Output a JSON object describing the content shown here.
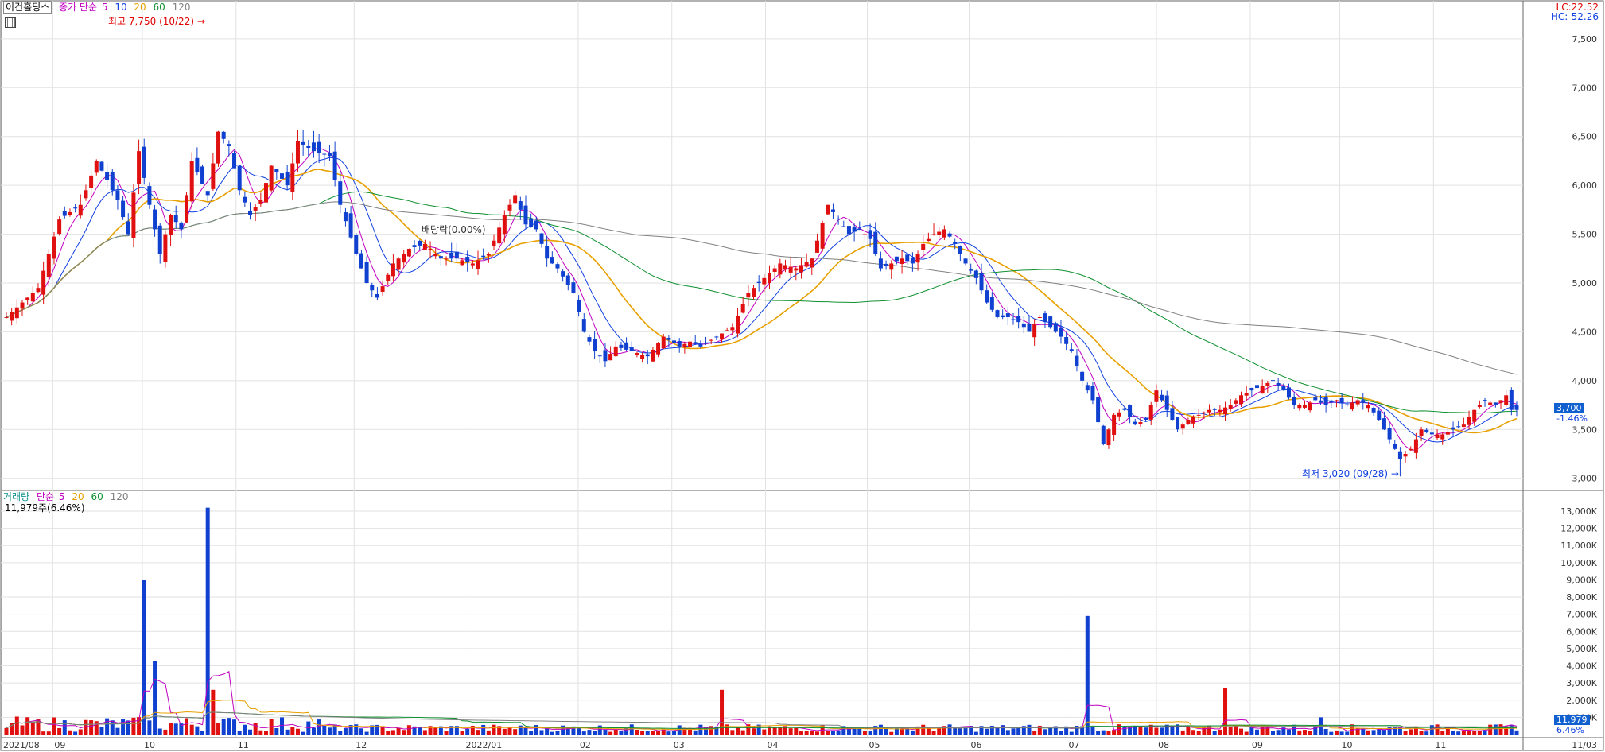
{
  "app": {
    "stock_name": "이건홀딩스",
    "toolbar_icon": "grid-icon"
  },
  "price_legend": {
    "label": "종가 단순",
    "ma": [
      {
        "period": "5",
        "color": "#e00000"
      },
      {
        "period": "10",
        "color": "#1040e0"
      },
      {
        "period": "20",
        "color": "#e8a000"
      },
      {
        "period": "60",
        "color": "#109030"
      },
      {
        "period": "120",
        "color": "#808080"
      }
    ],
    "label_color": "#c000c0"
  },
  "volume_legend": {
    "label": "거래량",
    "sublabel": "단순",
    "ma": [
      {
        "period": "5",
        "color": "#e00000"
      },
      {
        "period": "20",
        "color": "#e8a000"
      },
      {
        "period": "60",
        "color": "#109030"
      },
      {
        "period": "120",
        "color": "#808080"
      }
    ],
    "current": "11,979주(6.46%)"
  },
  "lc": "LC:22.52",
  "hc": "HC:-52.26",
  "annotations": {
    "high": "최고 7,750 (10/22)",
    "low": "최저 3,020 (09/28)",
    "dividend": "배당락(0.00%)"
  },
  "current_price": {
    "price": "3,700",
    "change": "-1.46%"
  },
  "current_volume": {
    "value": "11,979",
    "pct": "6.46%"
  },
  "colors": {
    "up": "#e01010",
    "down": "#1040d0",
    "grid": "#e2e2e2",
    "ma5": "#c000c0",
    "ma10": "#1040e0",
    "ma20": "#e8a000",
    "ma60": "#109030",
    "ma120": "#808080"
  },
  "chart_data": {
    "type": "candlestick",
    "x_axis_labels": [
      "2021/08",
      "09",
      "10",
      "11",
      "12",
      "2022/01",
      "02",
      "03",
      "04",
      "05",
      "06",
      "07",
      "08",
      "09",
      "10",
      "11",
      "11/03"
    ],
    "price_axis": {
      "ylim": [
        2900,
        7800
      ],
      "ticks": [
        "3,000",
        "3,500",
        "4,000",
        "4,500",
        "5,000",
        "5,500",
        "6,000",
        "6,500",
        "7,000",
        "7,500"
      ]
    },
    "volume_axis": {
      "ylim": [
        0,
        13600000
      ],
      "ticks": [
        "1,000K",
        "2,000K",
        "3,000K",
        "4,000K",
        "5,000K",
        "6,000K",
        "7,000K",
        "8,000K",
        "9,000K",
        "10,000K",
        "11,000K",
        "12,000K",
        "13,000K"
      ]
    },
    "close_anchors": [
      [
        0,
        4650
      ],
      [
        6,
        4950
      ],
      [
        10,
        5650
      ],
      [
        14,
        5800
      ],
      [
        17,
        6250
      ],
      [
        19,
        6050
      ],
      [
        21,
        5850
      ],
      [
        23,
        5500
      ],
      [
        25,
        6350
      ],
      [
        27,
        5800
      ],
      [
        29,
        5300
      ],
      [
        31,
        5700
      ],
      [
        33,
        5550
      ],
      [
        35,
        6250
      ],
      [
        38,
        5900
      ],
      [
        40,
        6550
      ],
      [
        42,
        6400
      ],
      [
        44,
        5950
      ],
      [
        46,
        5700
      ],
      [
        48,
        5850
      ],
      [
        50,
        6200
      ],
      [
        53,
        6000
      ],
      [
        55,
        6450
      ],
      [
        58,
        6350
      ],
      [
        61,
        6300
      ],
      [
        63,
        5800
      ],
      [
        66,
        5300
      ],
      [
        68,
        5000
      ],
      [
        70,
        4850
      ],
      [
        73,
        5200
      ],
      [
        76,
        5350
      ],
      [
        79,
        5400
      ],
      [
        82,
        5250
      ],
      [
        85,
        5250
      ],
      [
        88,
        5200
      ],
      [
        91,
        5300
      ],
      [
        94,
        5700
      ],
      [
        96,
        5900
      ],
      [
        98,
        5600
      ],
      [
        100,
        5550
      ],
      [
        102,
        5250
      ],
      [
        104,
        5150
      ],
      [
        107,
        4900
      ],
      [
        109,
        4500
      ],
      [
        111,
        4300
      ],
      [
        113,
        4200
      ],
      [
        115,
        4350
      ],
      [
        118,
        4300
      ],
      [
        121,
        4250
      ],
      [
        124,
        4450
      ],
      [
        127,
        4350
      ],
      [
        129,
        4400
      ],
      [
        131,
        4350
      ],
      [
        134,
        4450
      ],
      [
        137,
        4550
      ],
      [
        140,
        4900
      ],
      [
        143,
        5050
      ],
      [
        146,
        5200
      ],
      [
        149,
        5150
      ],
      [
        152,
        5250
      ],
      [
        155,
        5800
      ],
      [
        157,
        5650
      ],
      [
        159,
        5500
      ],
      [
        161,
        5550
      ],
      [
        163,
        5450
      ],
      [
        165,
        5150
      ],
      [
        167,
        5200
      ],
      [
        169,
        5250
      ],
      [
        171,
        5200
      ],
      [
        173,
        5400
      ],
      [
        175,
        5500
      ],
      [
        177,
        5550
      ],
      [
        179,
        5400
      ],
      [
        181,
        5200
      ],
      [
        183,
        5050
      ],
      [
        185,
        4800
      ],
      [
        187,
        4650
      ],
      [
        189,
        4650
      ],
      [
        191,
        4600
      ],
      [
        193,
        4500
      ],
      [
        195,
        4650
      ],
      [
        197,
        4550
      ],
      [
        199,
        4450
      ],
      [
        201,
        4300
      ],
      [
        203,
        4000
      ],
      [
        205,
        3800
      ],
      [
        207,
        3350
      ],
      [
        209,
        3650
      ],
      [
        211,
        3700
      ],
      [
        213,
        3550
      ],
      [
        215,
        3600
      ],
      [
        217,
        3900
      ],
      [
        219,
        3700
      ],
      [
        221,
        3500
      ],
      [
        223,
        3600
      ],
      [
        225,
        3650
      ],
      [
        227,
        3700
      ],
      [
        229,
        3700
      ],
      [
        231,
        3750
      ],
      [
        233,
        3850
      ],
      [
        235,
        3900
      ],
      [
        237,
        3950
      ],
      [
        239,
        4000
      ],
      [
        241,
        3900
      ],
      [
        243,
        3750
      ],
      [
        245,
        3750
      ],
      [
        247,
        3800
      ],
      [
        249,
        3750
      ],
      [
        251,
        3800
      ],
      [
        253,
        3750
      ],
      [
        255,
        3800
      ],
      [
        257,
        3750
      ],
      [
        259,
        3600
      ],
      [
        261,
        3400
      ],
      [
        263,
        3200
      ],
      [
        265,
        3300
      ],
      [
        267,
        3500
      ],
      [
        269,
        3450
      ],
      [
        271,
        3450
      ],
      [
        273,
        3500
      ],
      [
        275,
        3550
      ],
      [
        277,
        3700
      ],
      [
        279,
        3800
      ],
      [
        281,
        3750
      ],
      [
        283,
        3850
      ],
      [
        284,
        3700
      ]
    ],
    "volume_spikes": [
      [
        34,
        9000000
      ],
      [
        37,
        4300000
      ],
      [
        49,
        13200000
      ],
      [
        51,
        2600000
      ],
      [
        176,
        2600000
      ],
      [
        265,
        6900000
      ],
      [
        299,
        2700000
      ],
      [
        323,
        1000000
      ]
    ],
    "notable_values": {
      "high": 7750,
      "low": 3020,
      "last_close": 3700,
      "last_volume": 11979
    }
  }
}
